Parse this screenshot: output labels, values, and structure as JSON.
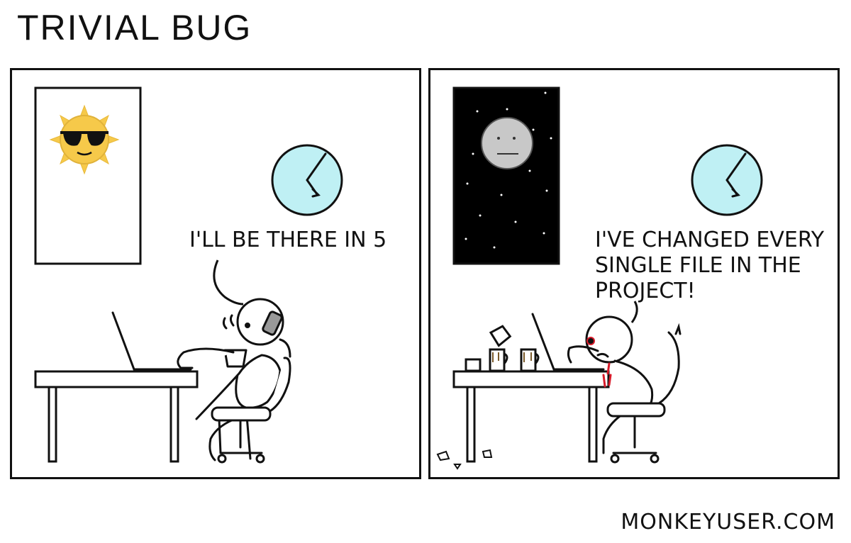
{
  "title": "TRIVIAL BUG",
  "panels": [
    {
      "speech": "I'LL BE THERE IN 5",
      "scene": "daytime",
      "window_icon": "sun-with-sunglasses-icon",
      "clock_icon": "clock-icon"
    },
    {
      "speech": "I'VE CHANGED EVERY\nSINGLE FILE IN THE\nPROJECT!",
      "scene": "night",
      "window_icon": "moon-icon",
      "clock_icon": "clock-icon"
    }
  ],
  "credit": "MONKEYUSER.COM",
  "colors": {
    "clock_face": "#bff0f4",
    "sun": "#f6c94a",
    "moon": "#c8c8c8",
    "night_sky": "#000000",
    "blood": "#d81b2a"
  }
}
